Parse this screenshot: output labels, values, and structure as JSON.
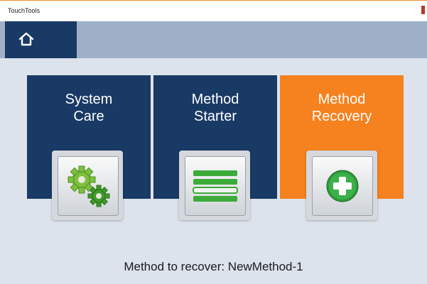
{
  "window": {
    "title": "TouchTools"
  },
  "nav": {
    "home_icon": "home-icon"
  },
  "tiles": [
    {
      "label": "System\nCare",
      "icon": "gears-icon",
      "color": "#1a3a66"
    },
    {
      "label": "Method\nStarter",
      "icon": "list-icon",
      "color": "#1a3a66"
    },
    {
      "label": "Method\nRecovery",
      "icon": "plus-circle-icon",
      "color": "#f5821f"
    }
  ],
  "status": {
    "text": "Method to recover: NewMethod-1"
  }
}
